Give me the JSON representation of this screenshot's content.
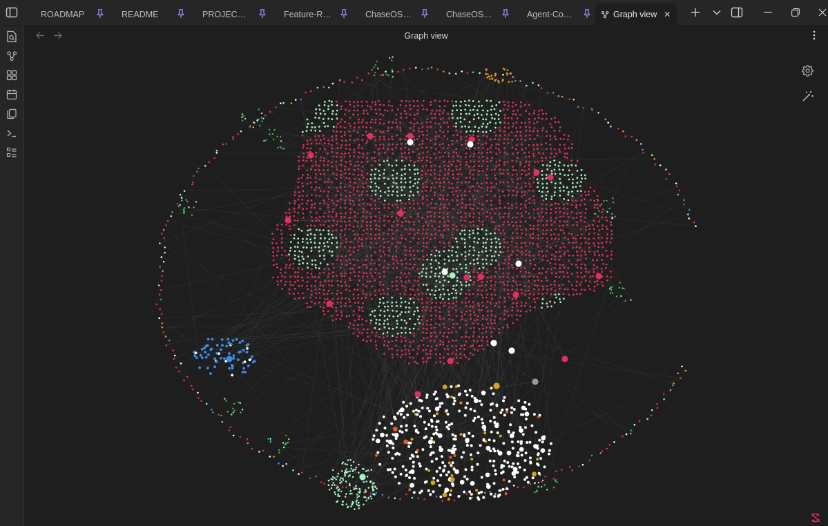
{
  "app": {
    "window_title": "Graph view"
  },
  "tabs": [
    {
      "label": "ROADMAP",
      "pinned": true,
      "active": false,
      "icon": ""
    },
    {
      "label": "README",
      "pinned": true,
      "active": false,
      "icon": ""
    },
    {
      "label": "PROJECT_FOU...",
      "pinned": true,
      "active": false,
      "icon": ""
    },
    {
      "label": "Feature-Register",
      "pinned": true,
      "active": false,
      "icon": ""
    },
    {
      "label": "ChaseOS-Studi...",
      "pinned": true,
      "active": false,
      "icon": ""
    },
    {
      "label": "ChaseOS-Gate",
      "pinned": true,
      "active": false,
      "icon": ""
    },
    {
      "label": "Agent-Control...",
      "pinned": true,
      "active": false,
      "icon": ""
    },
    {
      "label": "Graph view",
      "pinned": false,
      "active": true,
      "icon": "graph-icon"
    }
  ],
  "tabbar_actions": [
    "new-tab-icon",
    "tab-list-chevron-icon",
    "right-sidebar-toggle-icon",
    "minimize-icon",
    "restore-icon",
    "window-close-icon"
  ],
  "ribbon": [
    "search-files-icon",
    "graph-icon",
    "canvas-icon",
    "calendar-icon",
    "pages-icon",
    "terminal-icon",
    "list-icon"
  ],
  "pane": {
    "title": "Graph view",
    "nav": [
      "back-arrow-icon",
      "forward-arrow-icon"
    ],
    "more_menu_icon": "more-vertical-icon"
  },
  "graph_controls": [
    "settings-gear-icon",
    "magic-wand-icon"
  ],
  "bottom_status_icon": "sync-error-icon",
  "colors": {
    "background": "#1e1e1e",
    "node_pink": "#e0305e",
    "node_mint": "#a8f0c0",
    "node_white": "#ffffff",
    "node_blue": "#3a8ee6",
    "node_gold": "#d9a021",
    "node_green": "#3fbf5a",
    "node_orange": "#e0601e",
    "pin_purple": "#9d7fe8",
    "edge": "#5a5a5a"
  }
}
